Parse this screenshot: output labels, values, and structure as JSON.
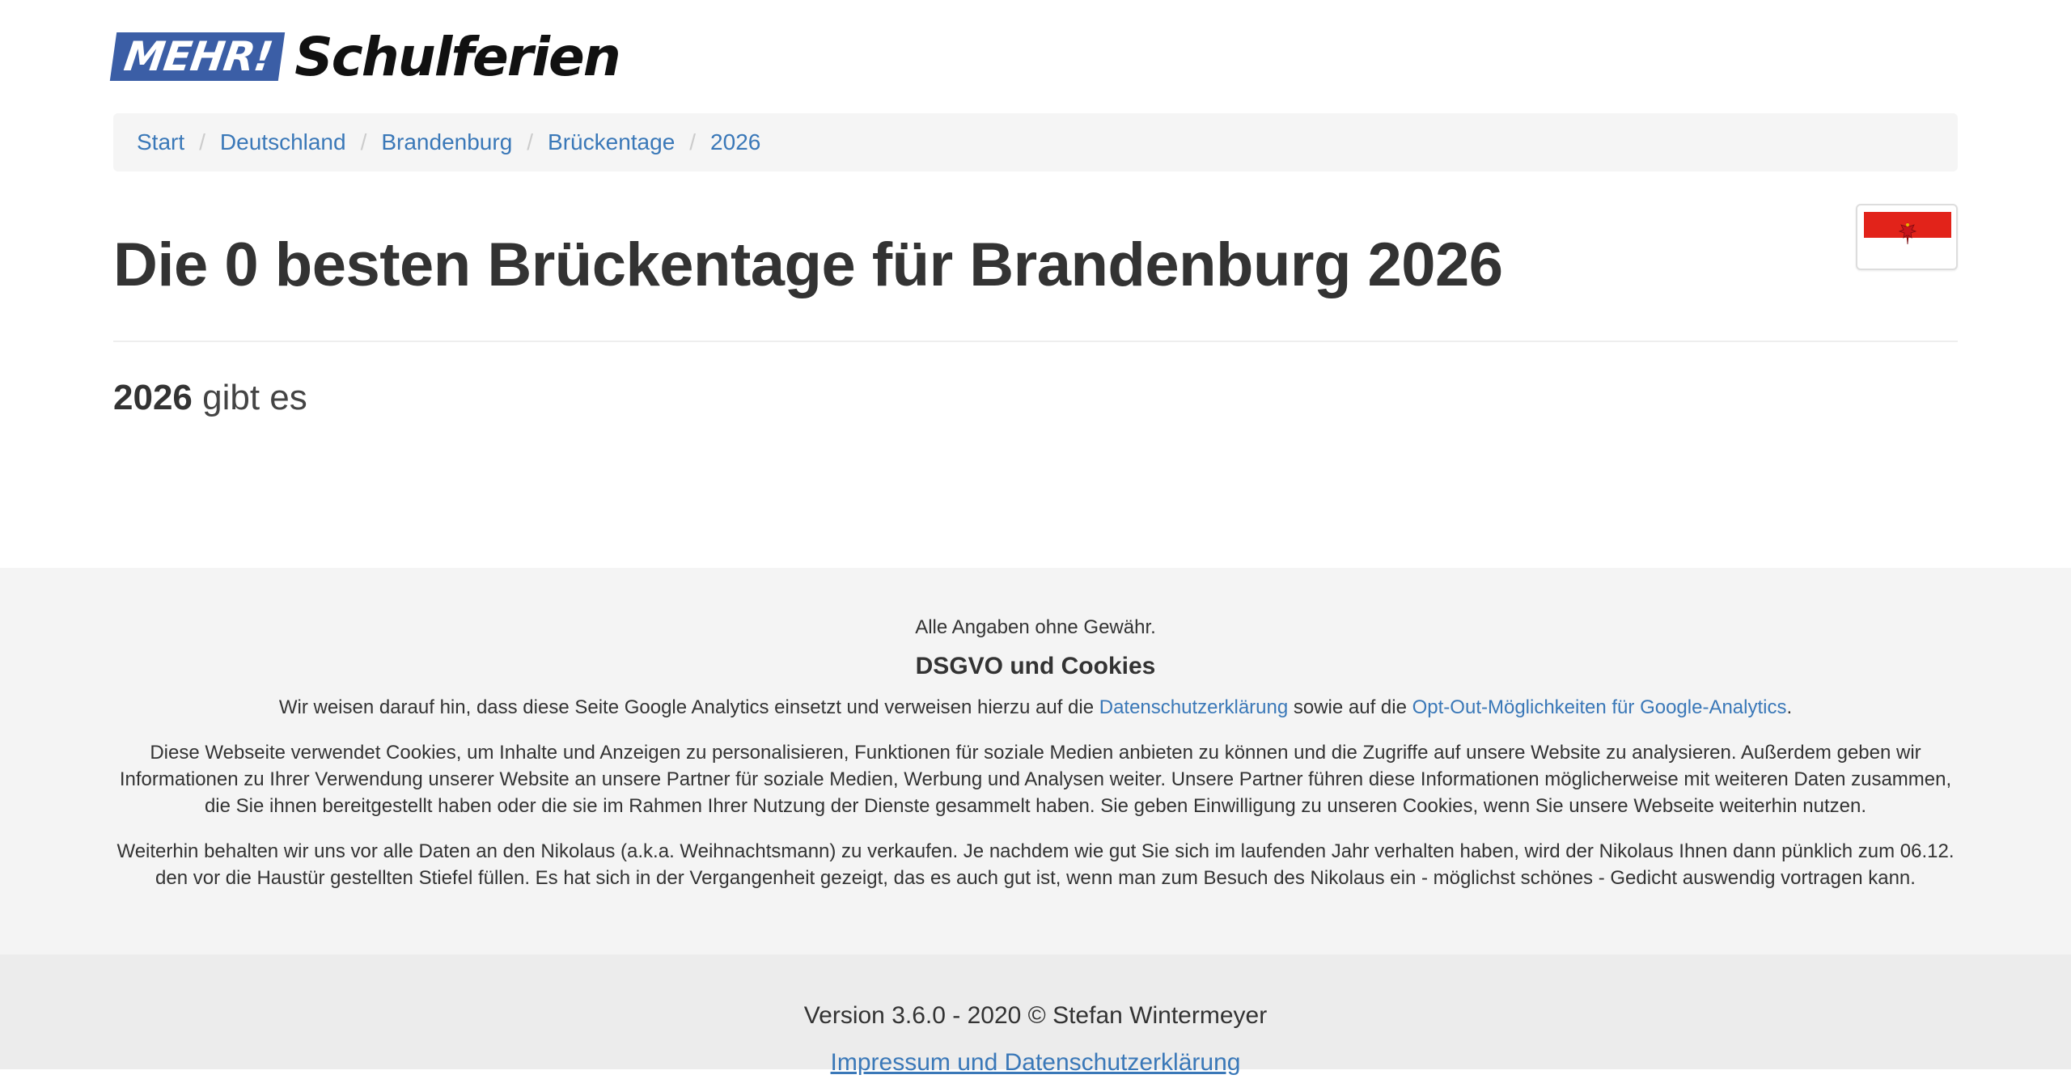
{
  "logo": {
    "mehr": "MEHR!",
    "schulferien": "Schulferien",
    "accent_color": "#3b5ea6"
  },
  "breadcrumb": {
    "items": [
      {
        "label": "Start"
      },
      {
        "label": "Deutschland"
      },
      {
        "label": "Brandenburg"
      },
      {
        "label": "Brückentage"
      },
      {
        "label": "2026"
      }
    ],
    "separator": "/",
    "link_color": "#3a78b8"
  },
  "flag": {
    "icon": "brandenburg-flag-icon",
    "colors": [
      "#e2231a",
      "#ffffff"
    ]
  },
  "main": {
    "title": "Die 0 besten Brückentage für Brandenburg 2026",
    "subtitle_year": "2026",
    "subtitle_text": "gibt es"
  },
  "footer": {
    "disclaimer": "Alle Angaben ohne Gewähr.",
    "dsgvo_heading": "DSGVO und Cookies",
    "analytics_text_1": "Wir weisen darauf hin, dass diese Seite Google Analytics einsetzt und verweisen hierzu auf die ",
    "analytics_link_1": "Datenschutzerklärung",
    "analytics_text_2": " sowie auf die ",
    "analytics_link_2": "Opt-Out-Möglichkeiten für Google-Analytics",
    "analytics_text_3": ".",
    "cookies_text": "Diese Webseite verwendet Cookies, um Inhalte und Anzeigen zu personalisieren, Funktionen für soziale Medien anbieten zu können und die Zugriffe auf unsere Website zu analysieren. Außerdem geben wir Informationen zu Ihrer Verwendung unserer Website an unsere Partner für soziale Medien, Werbung und Analysen weiter. Unsere Partner führen diese Informationen möglicherweise mit weiteren Daten zusammen, die Sie ihnen bereitgestellt haben oder die sie im Rahmen Ihrer Nutzung der Dienste gesammelt haben. Sie geben Einwilligung zu unseren Cookies, wenn Sie unsere Webseite weiterhin nutzen.",
    "nikolaus_text": "Weiterhin behalten wir uns vor alle Daten an den Nikolaus (a.k.a. Weihnachtsmann) zu verkaufen. Je nachdem wie gut Sie sich im laufenden Jahr verhalten haben, wird der Nikolaus Ihnen dann pünklich zum 06.12. den vor die Haustür gestellten Stiefel füllen. Es hat sich in der Vergangenheit gezeigt, das es auch gut ist, wenn man zum Besuch des Nikolaus ein - möglichst schönes - Gedicht auswendig vortragen kann.",
    "version": "Version 3.6.0 - 2020 © Stefan Wintermeyer",
    "impressum_link": "Impressum und Datenschutzerklärung"
  }
}
